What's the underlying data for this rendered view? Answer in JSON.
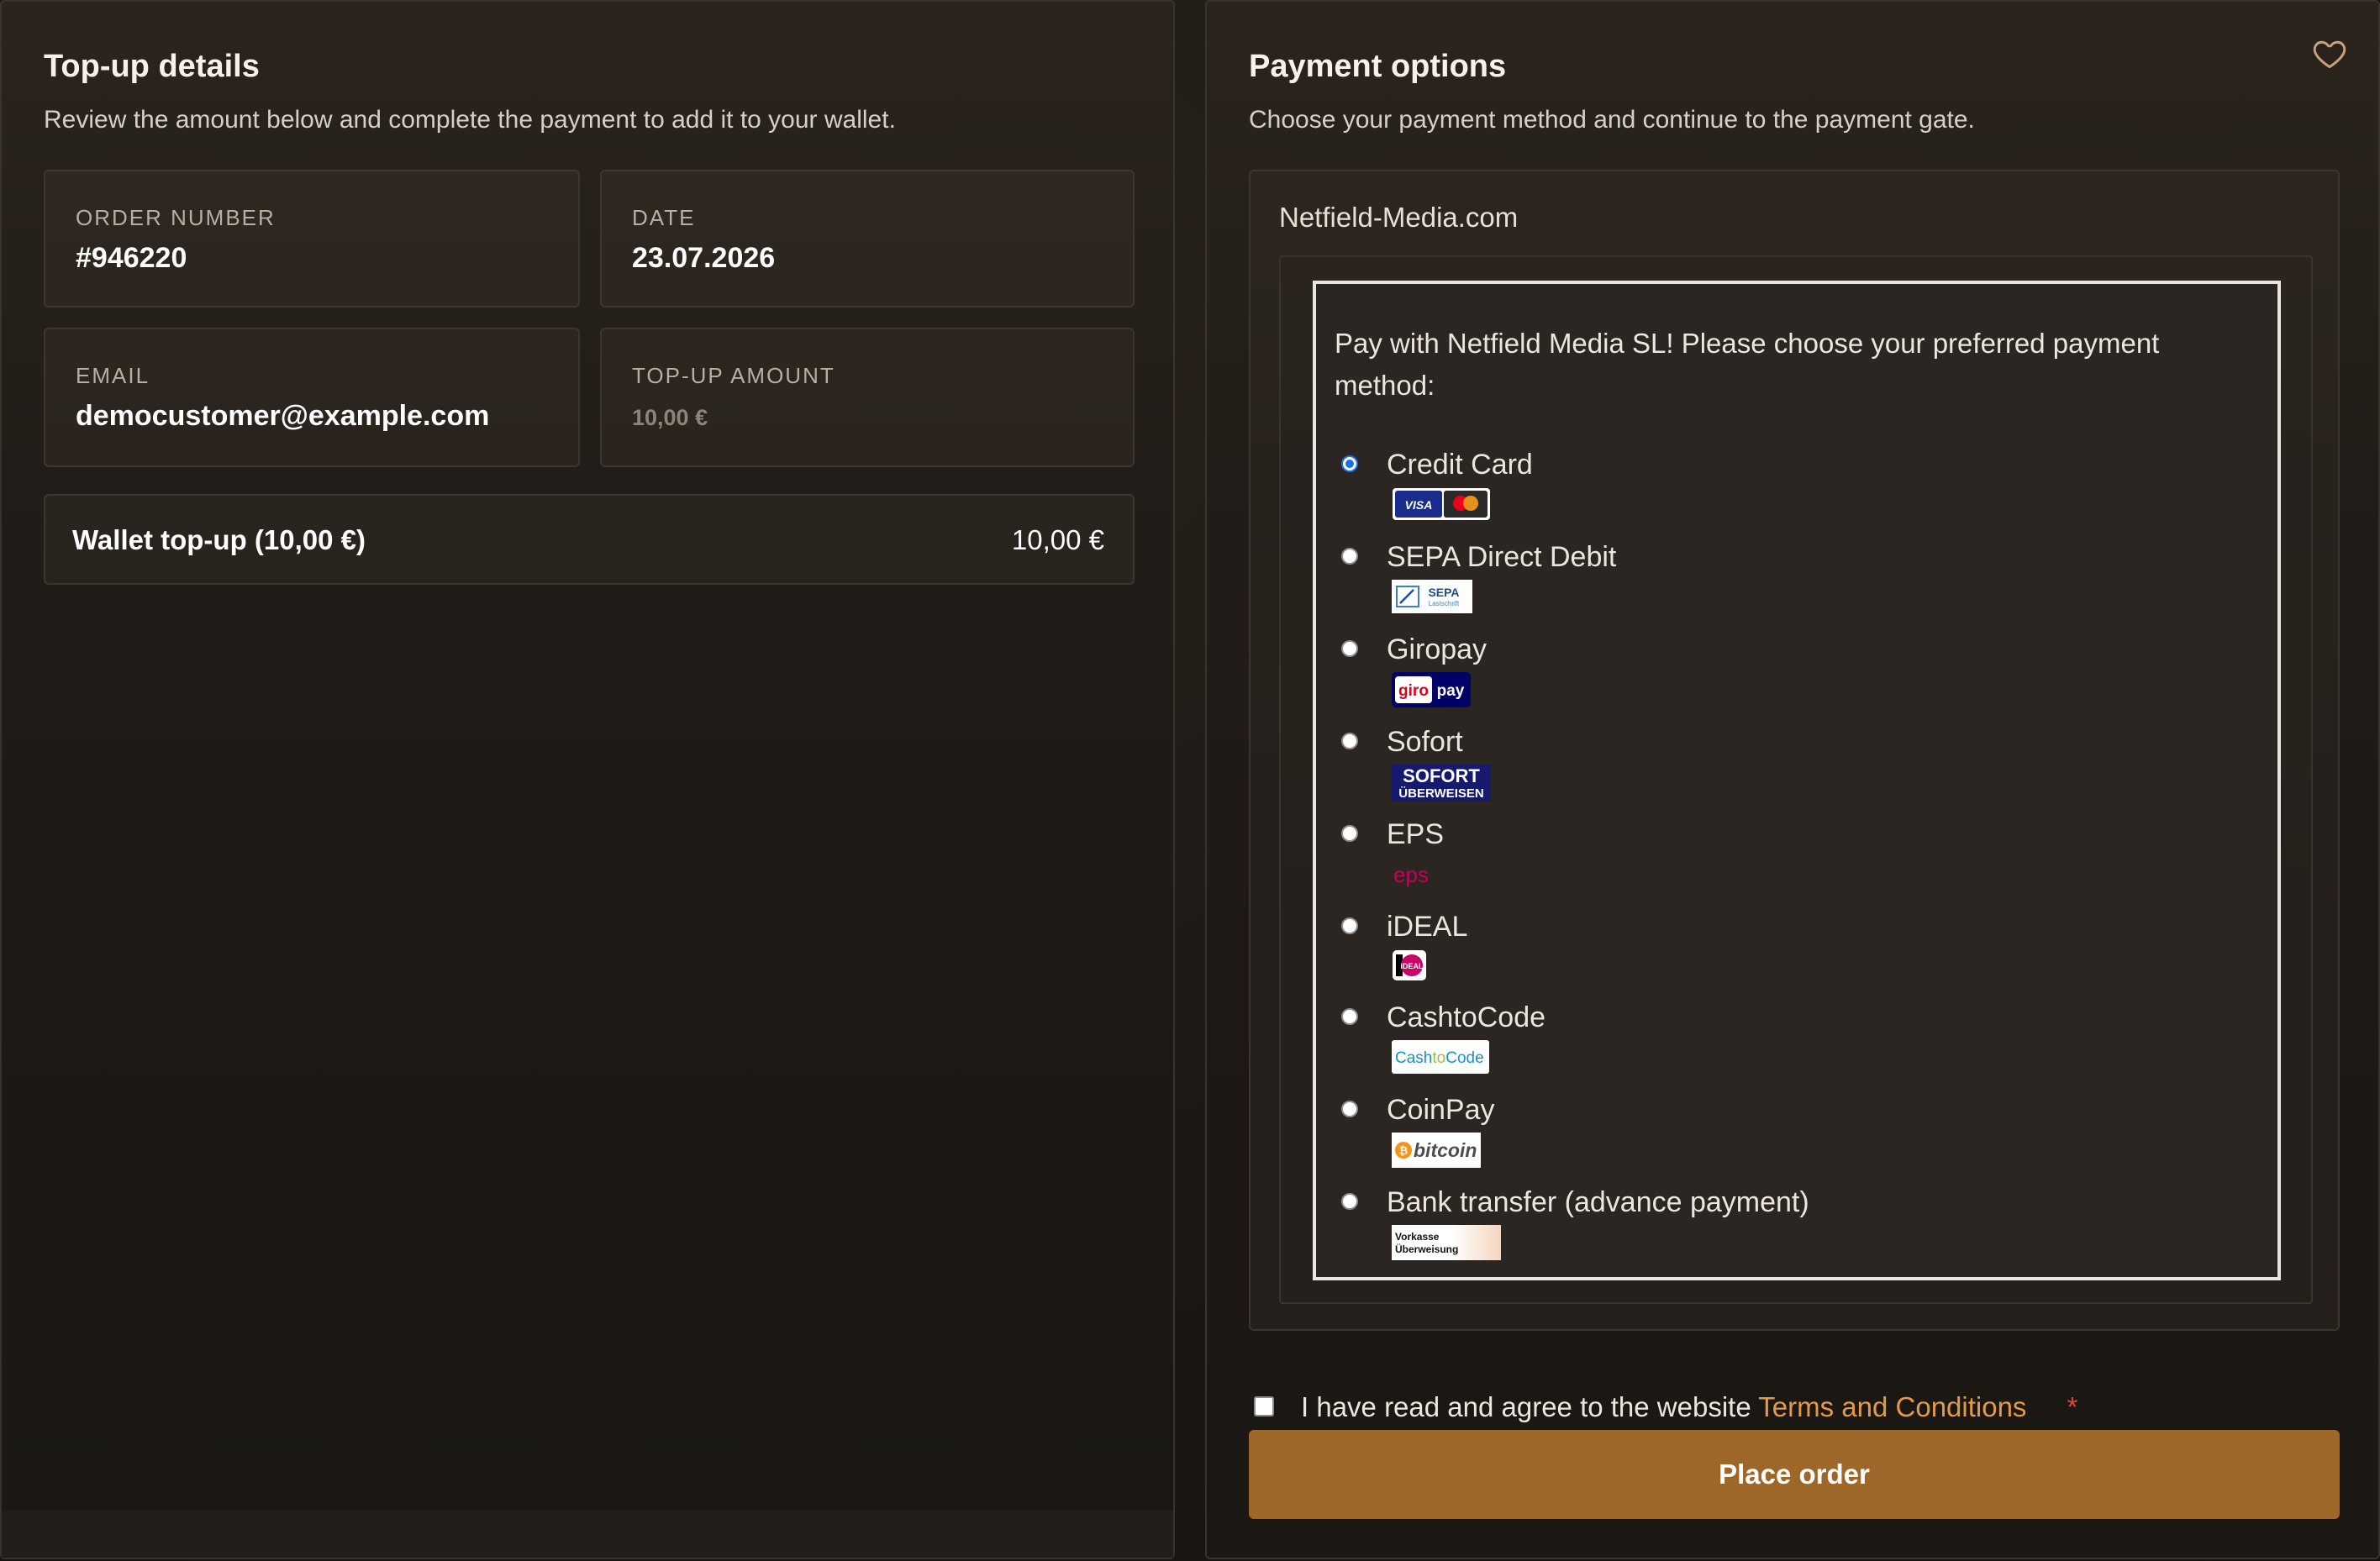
{
  "details": {
    "title": "Top-up details",
    "subtitle": "Review the amount below and complete the payment to add it to your wallet.",
    "order_number_label": "ORDER NUMBER",
    "order_number": "#946220",
    "date_label": "DATE",
    "date": "23.07.2026",
    "email_label": "EMAIL",
    "email": "democustomer@example.com",
    "amount_label": "TOP-UP AMOUNT",
    "amount": "10,00 €",
    "line_item_name": "Wallet top-up (10,00 €)",
    "line_item_amount": "10,00 €"
  },
  "payment": {
    "title": "Payment options",
    "subtitle": "Choose your payment method and continue to the payment gate.",
    "site": "Netfield-Media.com",
    "intro": "Pay with Netfield Media SL! Please choose your preferred payment method:",
    "selected": "Credit Card",
    "methods": [
      {
        "name": "Credit Card",
        "logo_text": [
          "VISA"
        ]
      },
      {
        "name": "SEPA Direct Debit",
        "logo_text": [
          "SEPA",
          "Lastschrift"
        ]
      },
      {
        "name": "Giropay",
        "logo_text": [
          "giro",
          "pay"
        ]
      },
      {
        "name": "Sofort",
        "logo_text": [
          "SOFORT",
          "ÜBERWEISEN"
        ]
      },
      {
        "name": "EPS",
        "logo_text": [
          "eps"
        ]
      },
      {
        "name": "iDEAL",
        "logo_text": [
          "iDEAL"
        ]
      },
      {
        "name": "CashtoCode",
        "logo_text": [
          "Cash",
          "to",
          "Code"
        ]
      },
      {
        "name": "CoinPay",
        "logo_text": [
          "bitcoin"
        ]
      },
      {
        "name": "Bank transfer (advance payment)",
        "logo_text": [
          "Vorkasse",
          "Überweisung"
        ]
      }
    ]
  },
  "agreement": {
    "text": "I have read and agree to the website ",
    "link": "Terms and Conditions",
    "required_mark": "*"
  },
  "place_order_label": "Place order",
  "icons": {
    "favorite": "heart-outline-icon"
  },
  "colors": {
    "accent": "#9e672a",
    "link": "#e39a46",
    "radio_selected": "#1a6fe8"
  }
}
